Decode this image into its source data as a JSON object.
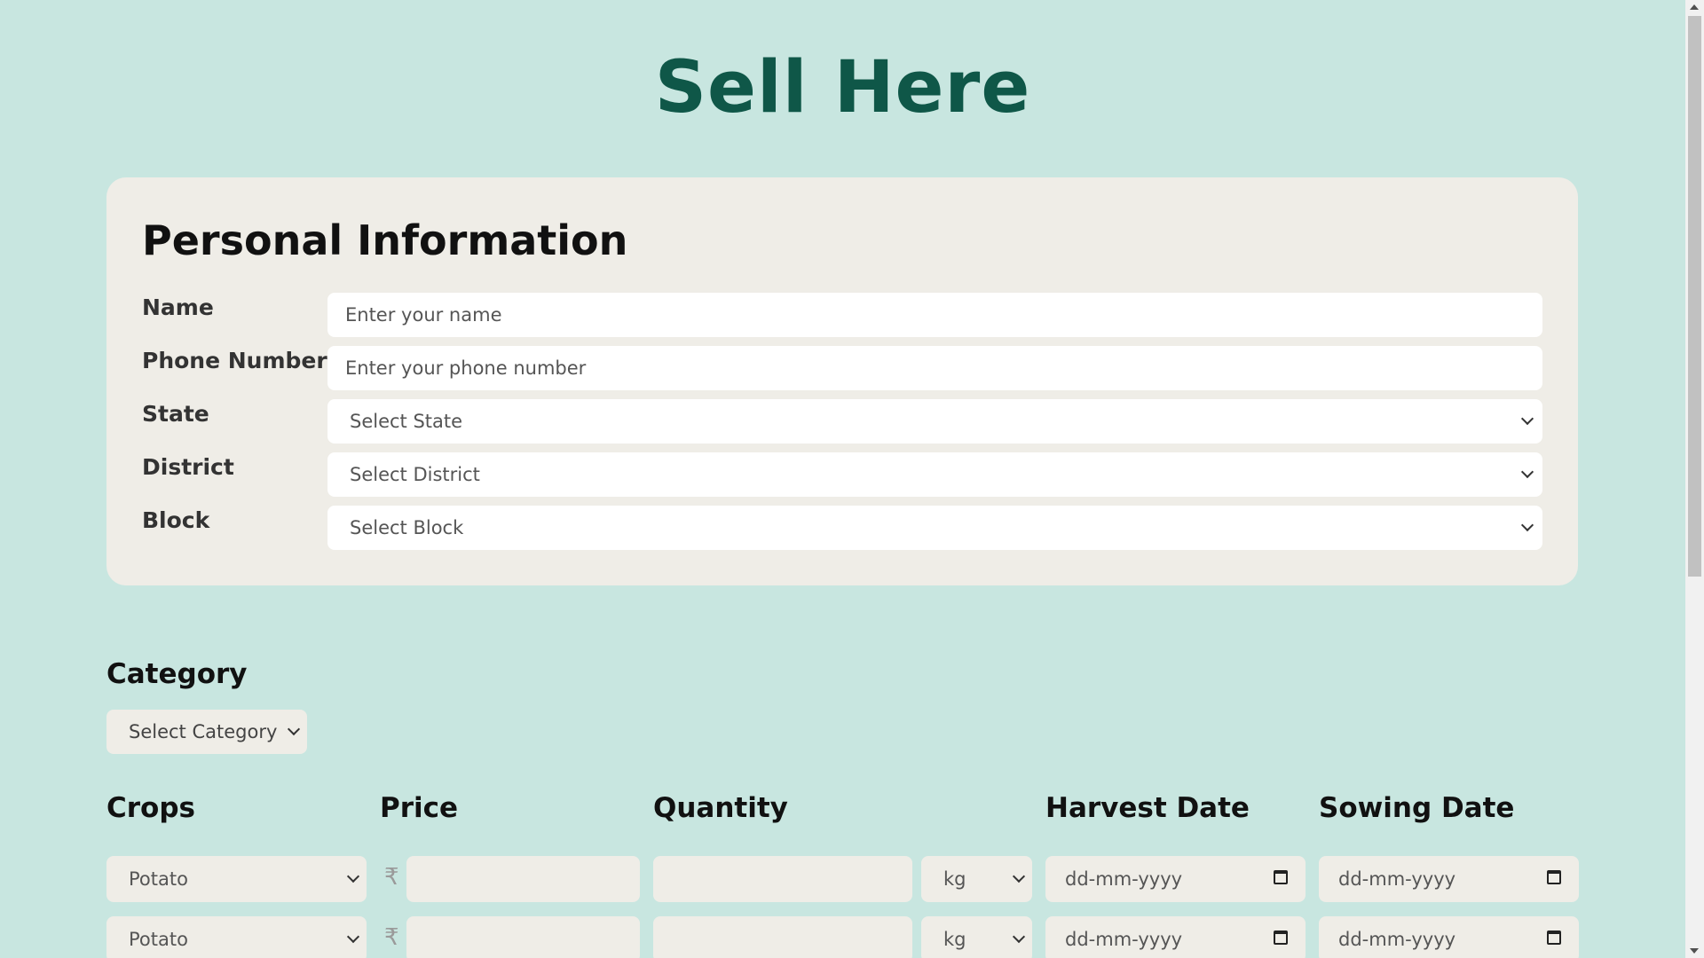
{
  "page": {
    "title": "Sell Here"
  },
  "personal": {
    "heading": "Personal Information",
    "name": {
      "label": "Name",
      "placeholder": "Enter your name"
    },
    "phone": {
      "label": "Phone Number",
      "placeholder": "Enter your phone number"
    },
    "state": {
      "label": "State",
      "value": "Select State"
    },
    "district": {
      "label": "District",
      "value": "Select District"
    },
    "block": {
      "label": "Block",
      "value": "Select Block"
    }
  },
  "category": {
    "label": "Category",
    "value": "Select Category"
  },
  "columns": {
    "crops": "Crops",
    "price": "Price",
    "quantity": "Quantity",
    "harvest": "Harvest Date",
    "sowing": "Sowing Date"
  },
  "rows": [
    {
      "crop": "Potato",
      "currency": "₹",
      "price": "",
      "quantity": "",
      "unit": "kg",
      "harvest": "dd-mm-yyyy",
      "sowing": "dd-mm-yyyy"
    },
    {
      "crop": "Potato",
      "currency": "₹",
      "price": "",
      "quantity": "",
      "unit": "kg",
      "harvest": "dd-mm-yyyy",
      "sowing": "dd-mm-yyyy"
    }
  ],
  "colors": {
    "background": "#c8e6e0",
    "title": "#0f5748",
    "card": "#efede7"
  },
  "icons": [
    "chevron-down-icon",
    "calendar-icon",
    "rupee-icon"
  ]
}
